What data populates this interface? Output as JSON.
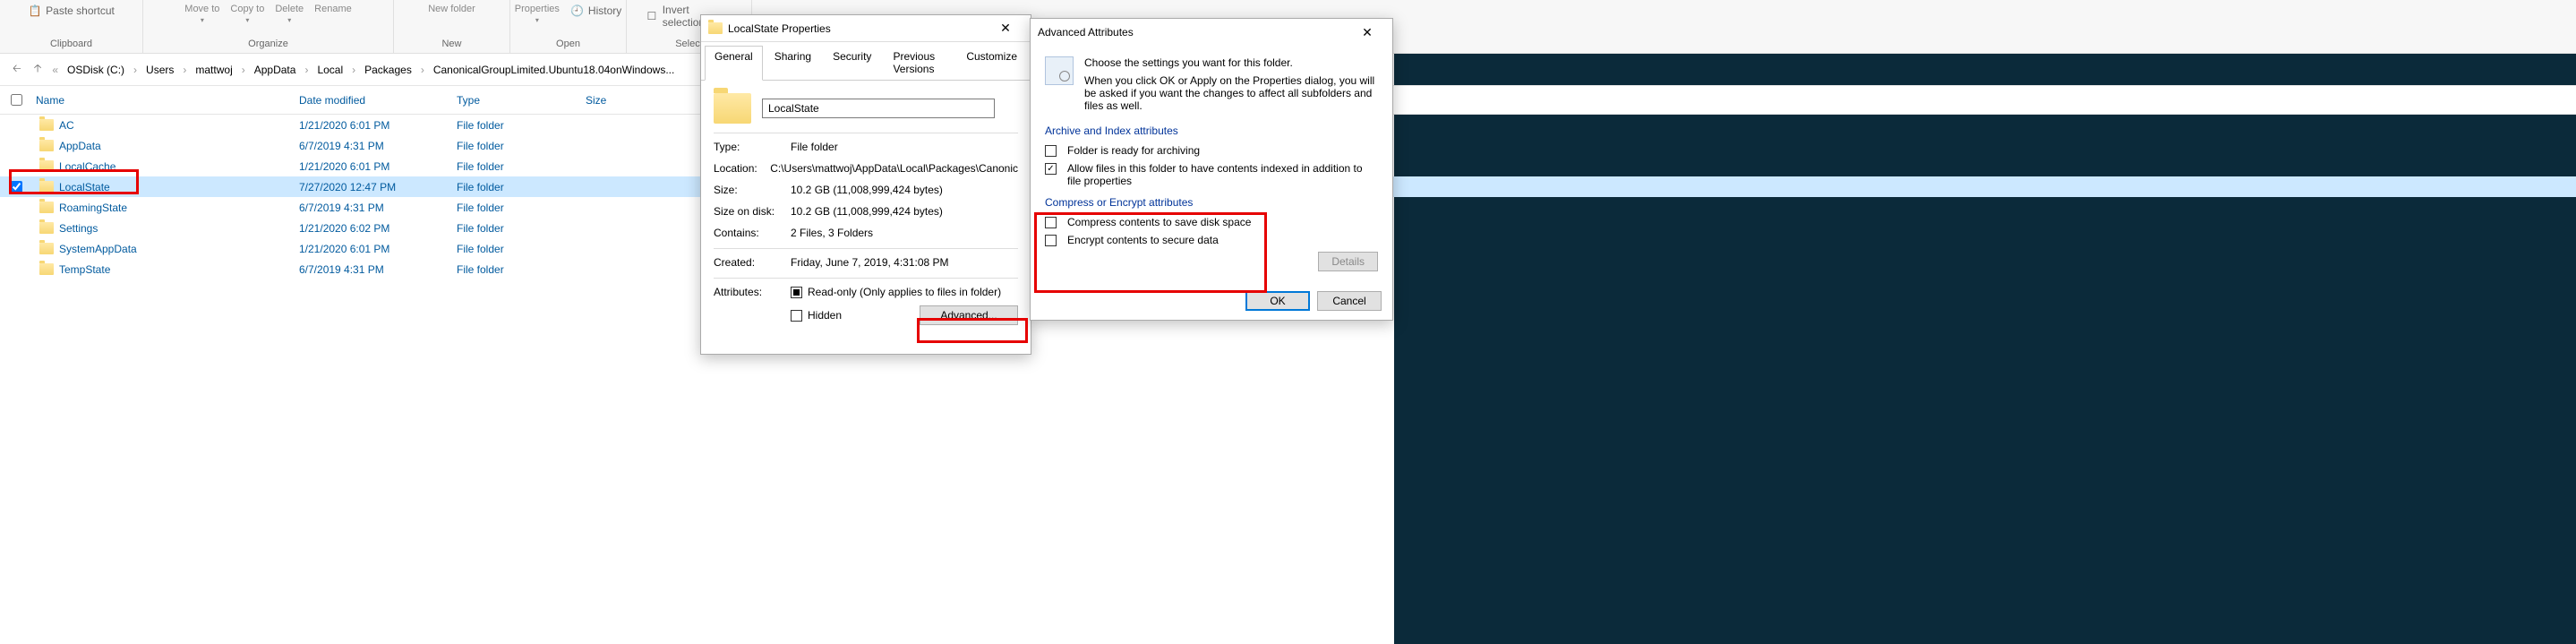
{
  "ribbon": {
    "paste_shortcut": "Paste shortcut",
    "move_to": "Move to",
    "copy_to": "Copy to",
    "delete": "Delete",
    "rename": "Rename",
    "new_folder": "New folder",
    "properties": "Properties",
    "history": "History",
    "invert_selection": "Invert selection",
    "groups": {
      "clipboard": "Clipboard",
      "organize": "Organize",
      "new": "New",
      "open": "Open",
      "select": "Select"
    }
  },
  "breadcrumb": {
    "items": [
      "OSDisk (C:)",
      "Users",
      "mattwoj",
      "AppData",
      "Local",
      "Packages",
      "CanonicalGroupLimited.Ubuntu18.04onWindows..."
    ]
  },
  "columns": {
    "name": "Name",
    "date": "Date modified",
    "type": "Type",
    "size": "Size"
  },
  "files": [
    {
      "name": "AC",
      "date": "1/21/2020 6:01 PM",
      "type": "File folder",
      "selected": false
    },
    {
      "name": "AppData",
      "date": "6/7/2019 4:31 PM",
      "type": "File folder",
      "selected": false
    },
    {
      "name": "LocalCache",
      "date": "1/21/2020 6:01 PM",
      "type": "File folder",
      "selected": false
    },
    {
      "name": "LocalState",
      "date": "7/27/2020 12:47 PM",
      "type": "File folder",
      "selected": true
    },
    {
      "name": "RoamingState",
      "date": "6/7/2019 4:31 PM",
      "type": "File folder",
      "selected": false
    },
    {
      "name": "Settings",
      "date": "1/21/2020 6:02 PM",
      "type": "File folder",
      "selected": false
    },
    {
      "name": "SystemAppData",
      "date": "1/21/2020 6:01 PM",
      "type": "File folder",
      "selected": false
    },
    {
      "name": "TempState",
      "date": "6/7/2019 4:31 PM",
      "type": "File folder",
      "selected": false
    }
  ],
  "props": {
    "title": "LocalState Properties",
    "tabs": [
      "General",
      "Sharing",
      "Security",
      "Previous Versions",
      "Customize"
    ],
    "name_value": "LocalState",
    "type_label": "Type:",
    "type_value": "File folder",
    "location_label": "Location:",
    "location_value": "C:\\Users\\mattwoj\\AppData\\Local\\Packages\\Canonic",
    "size_label": "Size:",
    "size_value": "10.2 GB (11,008,999,424 bytes)",
    "sizeondisk_label": "Size on disk:",
    "sizeondisk_value": "10.2 GB (11,008,999,424 bytes)",
    "contains_label": "Contains:",
    "contains_value": "2 Files, 3 Folders",
    "created_label": "Created:",
    "created_value": "Friday, June 7, 2019, 4:31:08 PM",
    "attributes_label": "Attributes:",
    "readonly_label": "Read-only (Only applies to files in folder)",
    "hidden_label": "Hidden",
    "advanced_button": "Advanced..."
  },
  "adv": {
    "title": "Advanced Attributes",
    "intro1": "Choose the settings you want for this folder.",
    "intro2": "When you click OK or Apply on the Properties dialog, you will be asked if you want the changes to affect all subfolders and files as well.",
    "archive_heading": "Archive and Index attributes",
    "archive_ready": "Folder is ready for archiving",
    "index_allow": "Allow files in this folder to have contents indexed in addition to file properties",
    "compress_heading": "Compress or Encrypt attributes",
    "compress_label": "Compress contents to save disk space",
    "encrypt_label": "Encrypt contents to secure data",
    "details": "Details",
    "ok": "OK",
    "cancel": "Cancel"
  }
}
